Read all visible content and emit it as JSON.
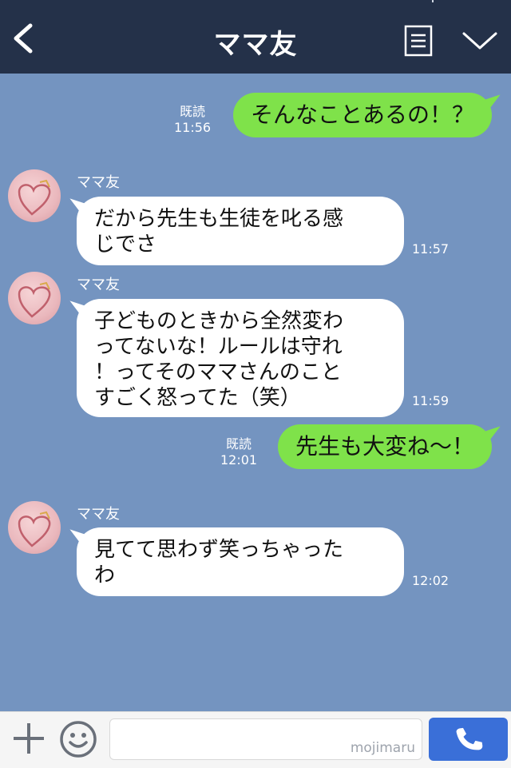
{
  "header": {
    "title": "ママ友",
    "back_icon": "chevron-left-icon",
    "menu_icon": "document-menu-icon",
    "dropdown_icon": "chevron-down-icon"
  },
  "messages": [
    {
      "side": "right",
      "read": "既読",
      "time": "11:56",
      "text": "そんなことあるの！？"
    },
    {
      "side": "left",
      "sender": "ママ友",
      "lines": [
        "だから先生も生徒を叱る感",
        "じでさ"
      ],
      "time": "11:57"
    },
    {
      "side": "left",
      "sender": "ママ友",
      "lines": [
        "子どものときから全然変わ",
        "ってないな！ルールは守れ",
        "！ってそのママさんのこと",
        "すごく怒ってた（笑）"
      ],
      "time": "11:59"
    },
    {
      "side": "right",
      "read": "既読",
      "time": "12:01",
      "text": "先生も大変ね～！"
    },
    {
      "side": "left",
      "sender": "ママ友",
      "lines": [
        "見てて思わず笑っちゃった",
        "わ"
      ],
      "time": "12:02"
    }
  ],
  "footer": {
    "input_value": "",
    "watermark": "mojimaru",
    "plus_icon": "plus-icon",
    "emoji_icon": "smiley-icon",
    "call_icon": "phone-icon"
  },
  "colors": {
    "background": "#7494c0",
    "header": "#243149",
    "bubble_green": "#7fe24a",
    "bubble_white": "#ffffff",
    "call_button": "#3a6fd8"
  }
}
